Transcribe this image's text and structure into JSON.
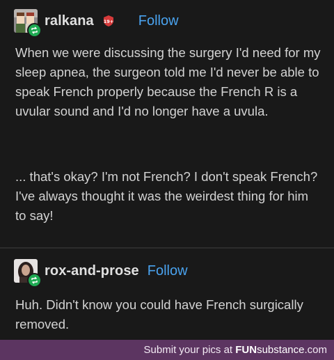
{
  "post1": {
    "username": "ralkana",
    "follow": "Follow",
    "badge_text": "19+",
    "paragraph1": "When we were discussing the surgery I'd need for my sleep apnea, the surgeon told me I'd never be able to speak French properly because the French R is a uvular sound and I'd no longer have a uvula.",
    "paragraph2": "... that's okay? I'm not French? I don't speak French? I've always thought it was the weirdest thing for him to say!"
  },
  "post2": {
    "username": "rox-and-prose",
    "follow": "Follow",
    "paragraph1": "Huh. Didn't know you could have French surgically removed."
  },
  "footer": {
    "prefix": "Submit your pics at ",
    "brand_fun": "FUN",
    "brand_sub": "substance",
    "brand_suffix": ".com"
  },
  "colors": {
    "background": "#191919",
    "text": "#d3d3d3",
    "follow_link": "#4aa3ef",
    "reblog_badge": "#1faa53",
    "footer_bar": "#5c3561",
    "nsfw_badge": "#d63a3a"
  },
  "icons": [
    "avatar",
    "reblog-icon",
    "nsfw-badge-icon"
  ]
}
